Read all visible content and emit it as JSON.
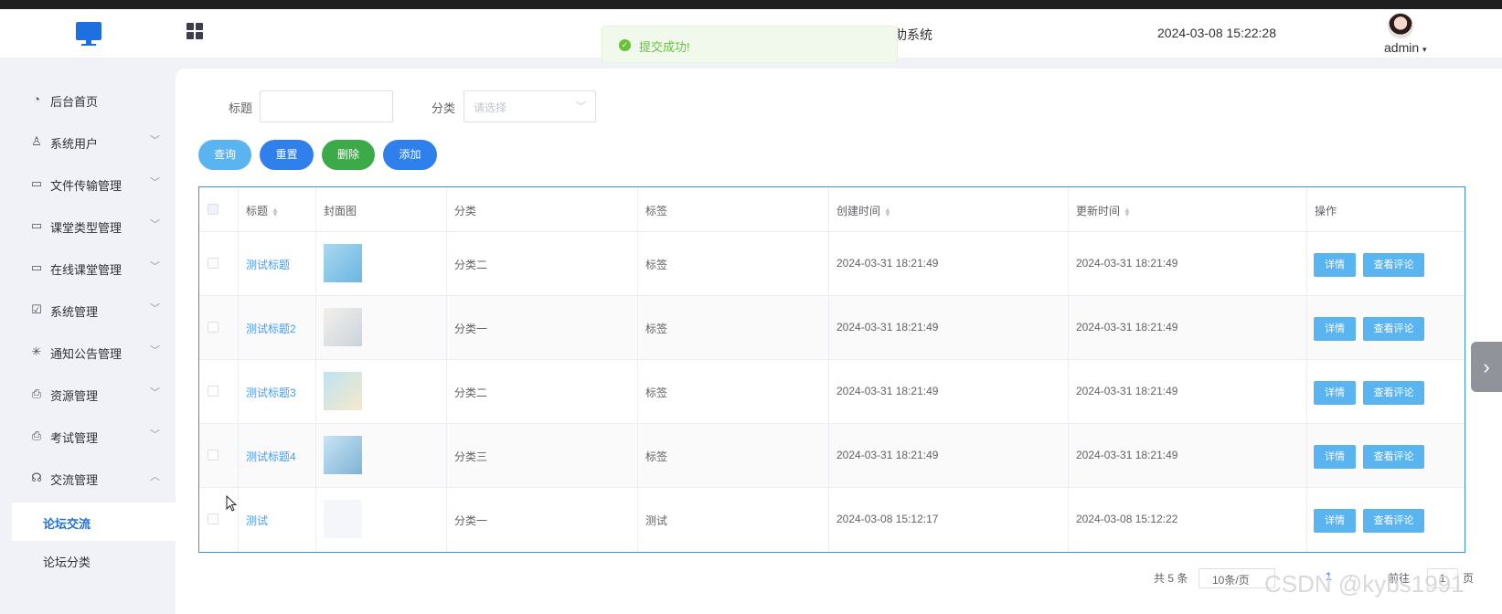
{
  "header": {
    "system_title": "助系统",
    "datetime": "2024-03-08 15:22:28",
    "user": "admin"
  },
  "toast": {
    "message": "提交成功!",
    "type": "success"
  },
  "sidebar": {
    "items": [
      {
        "label": "后台首页",
        "icon": "pie-chart-icon"
      },
      {
        "label": "系统用户",
        "icon": "user-icon"
      },
      {
        "label": "文件传输管理",
        "icon": "card-icon"
      },
      {
        "label": "课堂类型管理",
        "icon": "card-icon"
      },
      {
        "label": "在线课堂管理",
        "icon": "card-icon"
      },
      {
        "label": "系统管理",
        "icon": "folder-check-icon"
      },
      {
        "label": "通知公告管理",
        "icon": "loading-icon"
      },
      {
        "label": "资源管理",
        "icon": "printer-icon"
      },
      {
        "label": "考试管理",
        "icon": "printer-icon"
      },
      {
        "label": "交流管理",
        "icon": "headset-icon"
      }
    ],
    "submenu": [
      {
        "label": "论坛交流",
        "active": true
      },
      {
        "label": "论坛分类",
        "active": false
      }
    ]
  },
  "filters": {
    "title_label": "标题",
    "title_value": "",
    "category_label": "分类",
    "category_placeholder": "请选择"
  },
  "buttons": {
    "query": "查询",
    "reset": "重置",
    "delete": "删除",
    "add": "添加"
  },
  "table": {
    "columns": [
      "标题",
      "封面图",
      "分类",
      "标签",
      "创建时间",
      "更新时间",
      "操作"
    ],
    "rows": [
      {
        "title": "测试标题",
        "category": "分类二",
        "tag": "标签",
        "created": "2024-03-31 18:21:49",
        "updated": "2024-03-31 18:21:49"
      },
      {
        "title": "测试标题2",
        "category": "分类一",
        "tag": "标签",
        "created": "2024-03-31 18:21:49",
        "updated": "2024-03-31 18:21:49"
      },
      {
        "title": "测试标题3",
        "category": "分类二",
        "tag": "标签",
        "created": "2024-03-31 18:21:49",
        "updated": "2024-03-31 18:21:49"
      },
      {
        "title": "测试标题4",
        "category": "分类三",
        "tag": "标签",
        "created": "2024-03-31 18:21:49",
        "updated": "2024-03-31 18:21:49"
      },
      {
        "title": "测试",
        "category": "分类一",
        "tag": "测试",
        "created": "2024-03-08 15:12:17",
        "updated": "2024-03-08 15:12:22"
      }
    ],
    "action_detail": "详情",
    "action_comments": "查看评论"
  },
  "pagination": {
    "total": "共 5 条",
    "page_size": "10条/页",
    "current_page": "1",
    "goto_prefix": "前往",
    "goto_value": "1",
    "goto_suffix": "页"
  },
  "watermark": "CSDN @kybs1991",
  "colors": {
    "accent": "#1e6fe0",
    "query_btn": "#5ab4ef",
    "reset_btn": "#2f80ed",
    "delete_btn": "#3daa4a",
    "add_btn": "#2f80ed",
    "success": "#67c23a"
  }
}
